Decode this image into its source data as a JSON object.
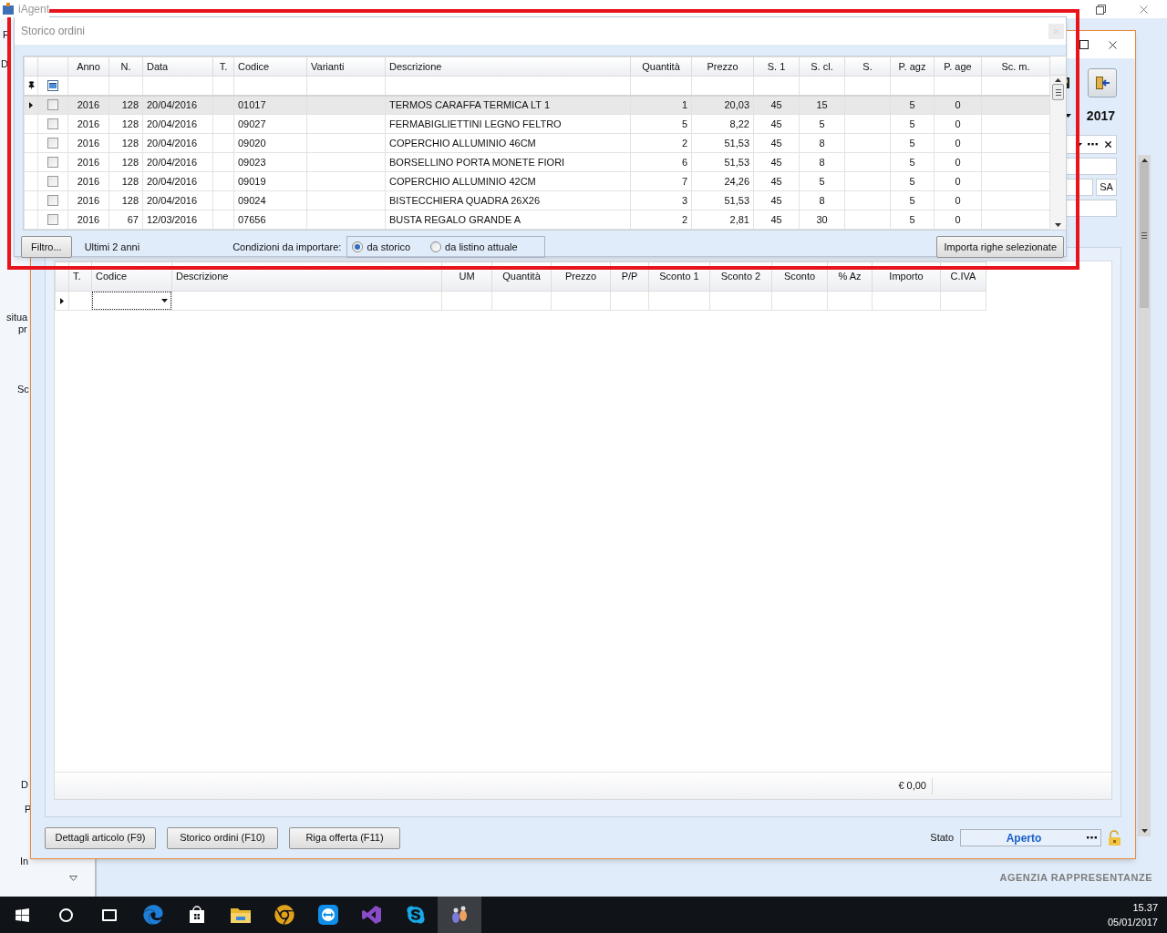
{
  "app": {
    "title": "iAgent",
    "sidebar_fragments": [
      {
        "text": "F"
      },
      {
        "text": "D"
      },
      {
        "text": "situa"
      },
      {
        "text": "pr"
      },
      {
        "text": "Sc"
      },
      {
        "text": "D"
      },
      {
        "text": "P"
      },
      {
        "text": "In"
      }
    ],
    "company": "AGENZIA RAPPRESENTANZE"
  },
  "order_dialog": {
    "year": "2017",
    "code_button": "SA",
    "columns": [
      "T.",
      "Codice",
      "Descrizione",
      "UM",
      "Quantità",
      "Prezzo",
      "P/P",
      "Sconto 1",
      "Sconto 2",
      "Sconto",
      "% Az",
      "Importo",
      "C.IVA"
    ],
    "total": "€ 0,00",
    "buttons": [
      "Dettagli articolo (F9)",
      "Storico ordini (F10)",
      "Riga offerta (F11)"
    ],
    "status_label": "Stato",
    "status": "Aperto"
  },
  "history_dialog": {
    "title": "Storico ordini",
    "select_all_partial": true,
    "columns": [
      "Anno",
      "N.",
      "Data",
      "T.",
      "Codice",
      "Varianti",
      "Descrizione",
      "Quantità",
      "Prezzo",
      "S. 1",
      "S. cl.",
      "S.",
      "P. agz",
      "P. age",
      "Sc. m."
    ],
    "rows": [
      {
        "selected": true,
        "checked": false,
        "anno": "2016",
        "n": "128",
        "data": "20/04/2016",
        "codice": "01017",
        "descrizione": "TERMOS CARAFFA TERMICA  LT 1",
        "quantita": "1",
        "prezzo": "20,03",
        "s1": "45",
        "s_cl": "15",
        "p_agz": "5",
        "p_age": "0"
      },
      {
        "selected": false,
        "checked": false,
        "anno": "2016",
        "n": "128",
        "data": "20/04/2016",
        "codice": "09027",
        "descrizione": "FERMABIGLIETTINI LEGNO FELTRO",
        "quantita": "5",
        "prezzo": "8,22",
        "s1": "45",
        "s_cl": "5",
        "p_agz": "5",
        "p_age": "0"
      },
      {
        "selected": false,
        "checked": false,
        "anno": "2016",
        "n": "128",
        "data": "20/04/2016",
        "codice": "09020",
        "descrizione": "COPERCHIO ALLUMINIO 46CM",
        "quantita": "2",
        "prezzo": "51,53",
        "s1": "45",
        "s_cl": "8",
        "p_agz": "5",
        "p_age": "0"
      },
      {
        "selected": false,
        "checked": false,
        "anno": "2016",
        "n": "128",
        "data": "20/04/2016",
        "codice": "09023",
        "descrizione": "BORSELLINO PORTA MONETE FIORI",
        "quantita": "6",
        "prezzo": "51,53",
        "s1": "45",
        "s_cl": "8",
        "p_agz": "5",
        "p_age": "0"
      },
      {
        "selected": false,
        "checked": false,
        "anno": "2016",
        "n": "128",
        "data": "20/04/2016",
        "codice": "09019",
        "descrizione": "COPERCHIO ALLUMINIO 42CM",
        "quantita": "7",
        "prezzo": "24,26",
        "s1": "45",
        "s_cl": "5",
        "p_agz": "5",
        "p_age": "0"
      },
      {
        "selected": false,
        "checked": false,
        "anno": "2016",
        "n": "128",
        "data": "20/04/2016",
        "codice": "09024",
        "descrizione": "BISTECCHIERA QUADRA 26X26",
        "quantita": "3",
        "prezzo": "51,53",
        "s1": "45",
        "s_cl": "8",
        "p_agz": "5",
        "p_age": "0"
      },
      {
        "selected": false,
        "checked": false,
        "anno": "2016",
        "n": "67",
        "data": "12/03/2016",
        "codice": "07656",
        "descrizione": "BUSTA REGALO GRANDE A",
        "quantita": "2",
        "prezzo": "2,81",
        "s1": "45",
        "s_cl": "30",
        "p_agz": "5",
        "p_age": "0"
      }
    ],
    "filter_button": "Filtro...",
    "filter_info": "Ultimi 2 anni",
    "import_label": "Condizioni da importare:",
    "import_options": [
      {
        "label": "da storico",
        "selected": true
      },
      {
        "label": "da listino attuale",
        "selected": false
      }
    ],
    "import_button": "Importa righe selezionate"
  },
  "taskbar": {
    "time": "15.37",
    "date": "05/01/2017"
  }
}
